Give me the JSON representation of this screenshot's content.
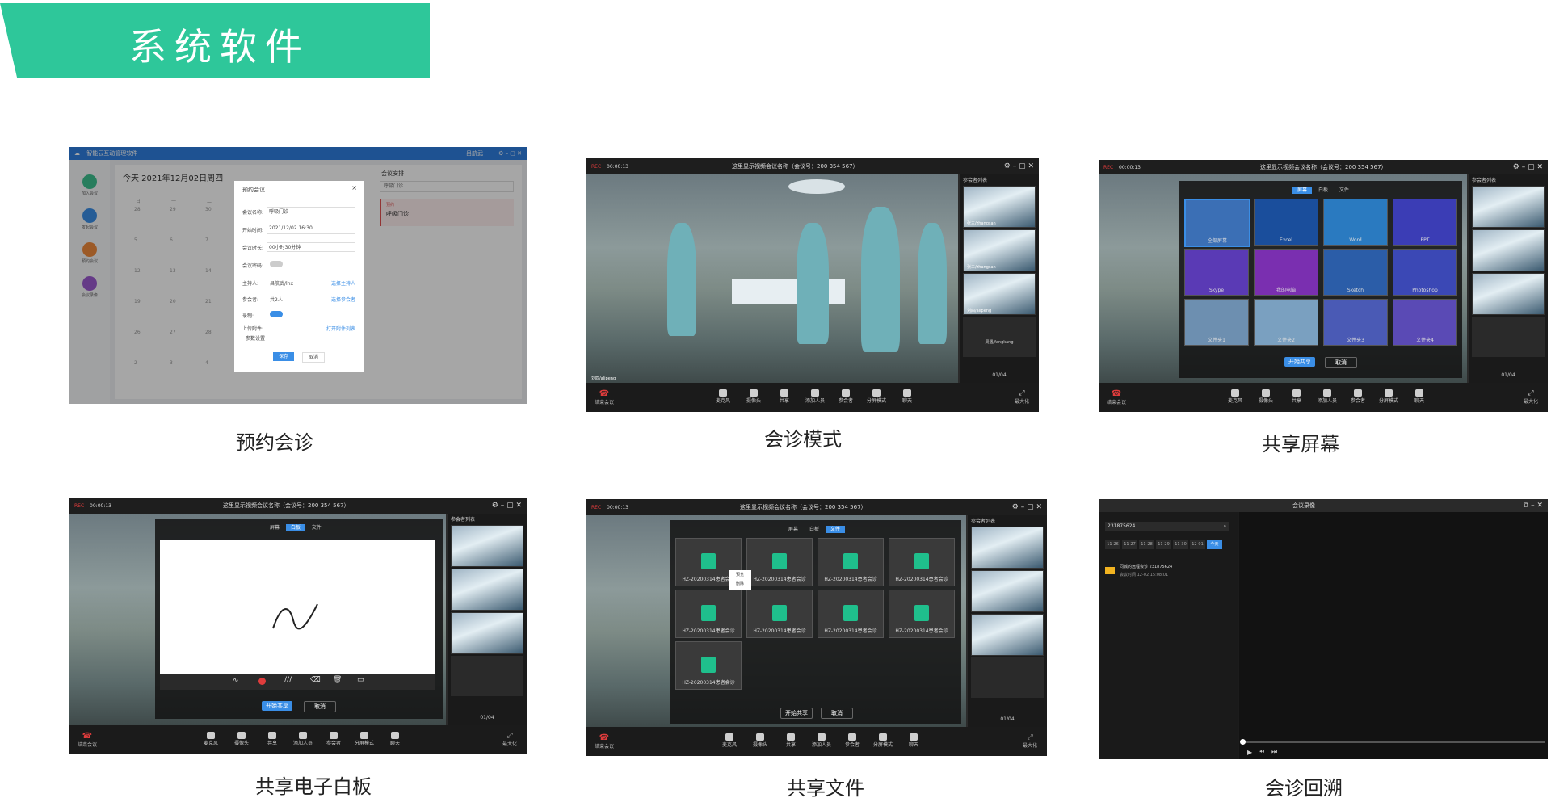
{
  "banner": {
    "title": "系统软件"
  },
  "captions": [
    "预约会诊",
    "会诊模式",
    "共享屏幕",
    "共享电子白板",
    "共享文件",
    "会诊回溯"
  ],
  "colors": {
    "accent": "#2ec79a",
    "blue": "#3a8ee6",
    "rec": "#e03c3c"
  },
  "booking": {
    "app_title": "智能云互动管理软件",
    "user": "吕航武",
    "date": "今天  2021年12月02日周四",
    "sidebar": [
      "加入会议",
      "发起会议",
      "预约会议",
      "会议录像"
    ],
    "weekdays": [
      "日",
      "一",
      "二"
    ],
    "calendar_nums": [
      "28",
      "29",
      "30",
      "5",
      "6",
      "7",
      "12",
      "13",
      "14",
      "19",
      "20",
      "21",
      "26",
      "27",
      "28",
      "2",
      "3",
      "4"
    ],
    "right_title": "会议安排",
    "right_search": "呼吸门诊",
    "right_item_tag": "预约",
    "right_item_title": "呼吸门诊",
    "dialog": {
      "title": "预约会议",
      "name_label": "会议名称:",
      "name_value": "呼吸门诊",
      "time_label": "开始时间:",
      "time_value": "2021/12/02 16:30",
      "duration_label": "会议时长:",
      "duration_value": "00小时30分钟",
      "password_label": "会议密码:",
      "host_label": "主持人:",
      "host_value": "吕航武/lhx",
      "host_link": "选择主持人",
      "participants_label": "参会者:",
      "participants_value": "共2人",
      "participants_link": "选择参会者",
      "record_label": "录制:",
      "attach_label": "上传附件:",
      "attach_link": "打开附件列表",
      "params_label": "参数设置",
      "save": "保存",
      "cancel": "取消"
    }
  },
  "meeting": {
    "rec": "REC",
    "timer": "00:00:13",
    "title": "这里显示视频会议名称（会议号：200 354 567）",
    "title2": "这里显示视频会议名称（会议号：200 354 567）",
    "participants_title": "参会者列表",
    "p1": "张三/zhangsan",
    "p2": "张三/zhangsan",
    "p3": "刘四/alipeng",
    "p4": "周遇/fangkang",
    "page": "01/04",
    "local_user": "刘四/alipeng",
    "end": "结束会议",
    "controls": [
      "麦克风",
      "摄像头",
      "共享",
      "添加人员",
      "参会者",
      "分屏模式",
      "聊天"
    ],
    "maximize": "最大化"
  },
  "share": {
    "tabs": [
      "屏幕",
      "白板",
      "文件"
    ],
    "screens": [
      "全部屏幕",
      "Excel",
      "Word",
      "PPT",
      "Skype",
      "我的电脑",
      "Sketch",
      "Photoshop",
      "文件夹1",
      "文件夹2",
      "文件夹3",
      "文件夹4"
    ],
    "start": "开始共享",
    "cancel": "取消"
  },
  "files": {
    "items": [
      "HZ-20200314患者会诊",
      "HZ-20200314患者会诊",
      "HZ-20200314患者会诊",
      "HZ-20200314患者会诊",
      "HZ-20200314患者会诊",
      "HZ-20200314患者会诊",
      "HZ-20200314患者会诊",
      "HZ-20200314患者会诊",
      "HZ-20200314患者会诊"
    ],
    "menu": [
      "预览",
      "删除"
    ]
  },
  "recording": {
    "title": "会议录像",
    "search": "231875624",
    "dates": [
      "11-26",
      "11-27",
      "11-28",
      "11-29",
      "11-30",
      "12-01",
      "今天"
    ],
    "item_title": "同城的远程会诊 231875624",
    "item_time": "会议时间  12-02 15:08:01"
  }
}
